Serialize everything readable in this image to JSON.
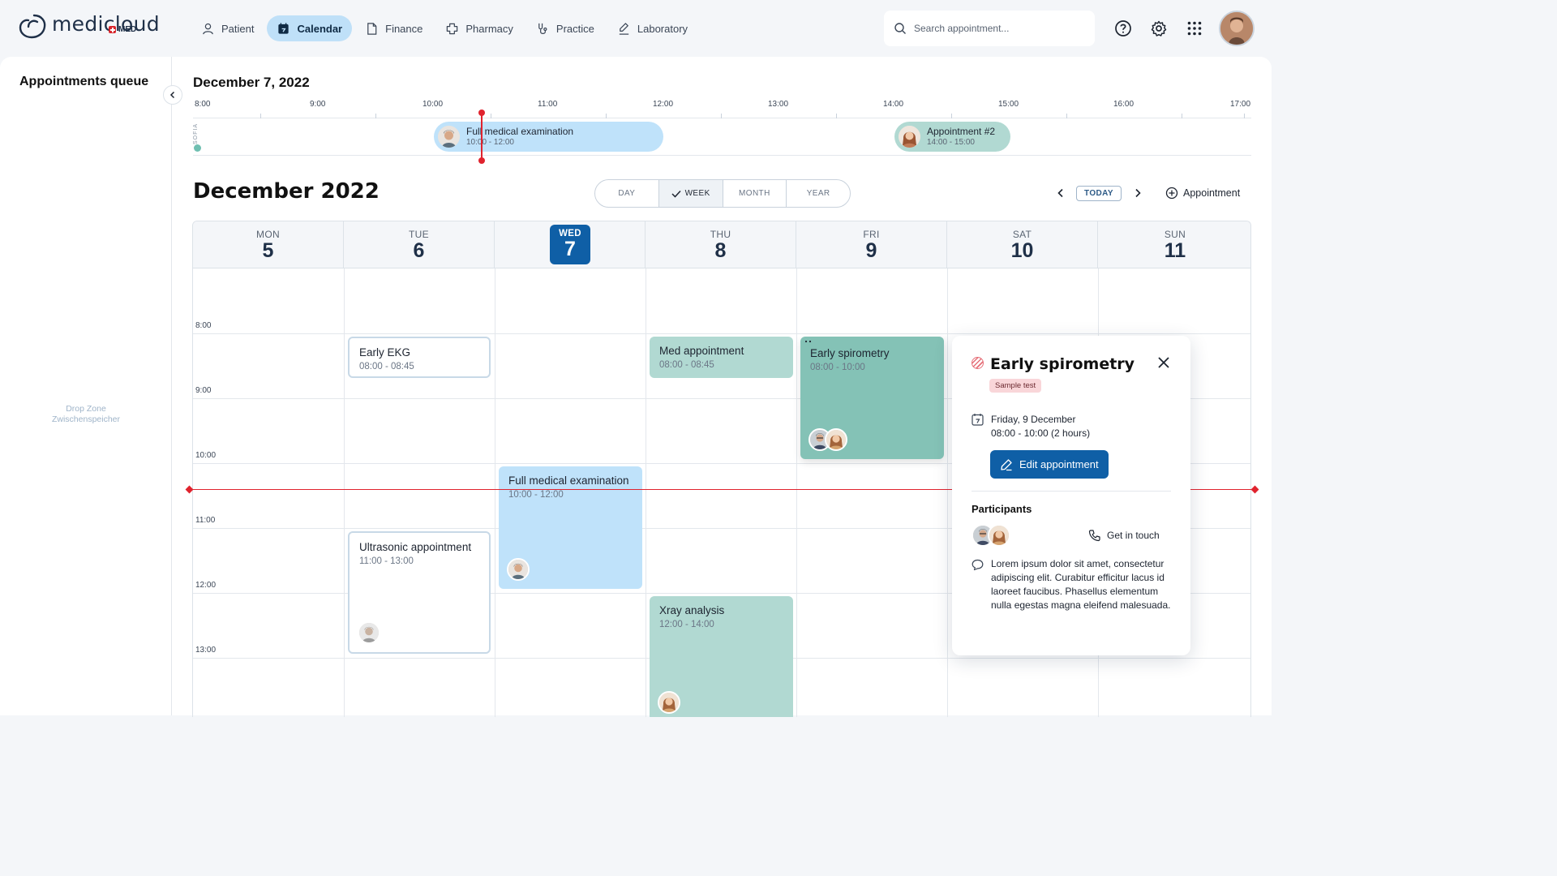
{
  "brand": {
    "name": "medicloud",
    "sub": "MED"
  },
  "nav": [
    {
      "label": "Patient",
      "icon": "user-icon"
    },
    {
      "label": "Calendar",
      "icon": "calendar-icon",
      "active": true
    },
    {
      "label": "Finance",
      "icon": "document-icon"
    },
    {
      "label": "Pharmacy",
      "icon": "pill-icon"
    },
    {
      "label": "Practice",
      "icon": "stethoscope-icon"
    },
    {
      "label": "Laboratory",
      "icon": "flask-icon"
    }
  ],
  "search": {
    "placeholder": "Search appointment..."
  },
  "queue": {
    "title": "Appointments queue",
    "dropzone_line1": "Drop Zone",
    "dropzone_line2": "Zwischenspeicher"
  },
  "day_view": {
    "date": "December 7, 2022",
    "hours": [
      "8:00",
      "9:00",
      "10:00",
      "11:00",
      "12:00",
      "13:00",
      "14:00",
      "15:00",
      "16:00",
      "17:00"
    ],
    "person": "SOFIA",
    "events": [
      {
        "title": "Full medical examination",
        "time": "10:00 - 12:00"
      },
      {
        "title": "Appointment #2",
        "time": "14:00 - 15:00"
      }
    ]
  },
  "month_title": "December 2022",
  "views": [
    "DAY",
    "WEEK",
    "MONTH",
    "YEAR"
  ],
  "active_view": "WEEK",
  "today_label": "TODAY",
  "add_label": "Appointment",
  "week_days": [
    {
      "name": "MON",
      "num": "5"
    },
    {
      "name": "TUE",
      "num": "6"
    },
    {
      "name": "WED",
      "num": "7",
      "today": true
    },
    {
      "name": "THU",
      "num": "8"
    },
    {
      "name": "FRI",
      "num": "9"
    },
    {
      "name": "SAT",
      "num": "10"
    },
    {
      "name": "SUN",
      "num": "11"
    }
  ],
  "week_hours": [
    "8:00",
    "9:00",
    "10:00",
    "11:00",
    "12:00",
    "13:00"
  ],
  "week_events": [
    {
      "title": "Early EKG",
      "time": "08:00 - 08:45"
    },
    {
      "title": "Med appointment",
      "time": "08:00 - 08:45"
    },
    {
      "title": "Early spirometry",
      "time": "08:00 - 10:00"
    },
    {
      "title": "Full medical examination",
      "time": "10:00 - 12:00"
    },
    {
      "title": "Ultrasonic appointment",
      "time": "11:00 - 13:00"
    },
    {
      "title": "Xray analysis",
      "time": "12:00 - 14:00"
    }
  ],
  "popover": {
    "title": "Early spirometry",
    "badge": "Sample test",
    "date": "Friday, 9 December",
    "time": "08:00 - 10:00 (2 hours)",
    "edit_label": "Edit appointment",
    "participants_label": "Participants",
    "touch_label": "Get in touch",
    "note": "Lorem ipsum dolor sit amet, consectetur adipiscing elit. Curabitur efficitur lacus id laoreet faucibus. Phasellus elementum nulla egestas magna eleifend malesuada."
  },
  "colors": {
    "accent": "#0f5fa6",
    "now_line": "#e0232e",
    "event_blue": "#bfe2fa",
    "event_teal": "#b1d9d2",
    "event_teal_dark": "#84c2b6"
  }
}
